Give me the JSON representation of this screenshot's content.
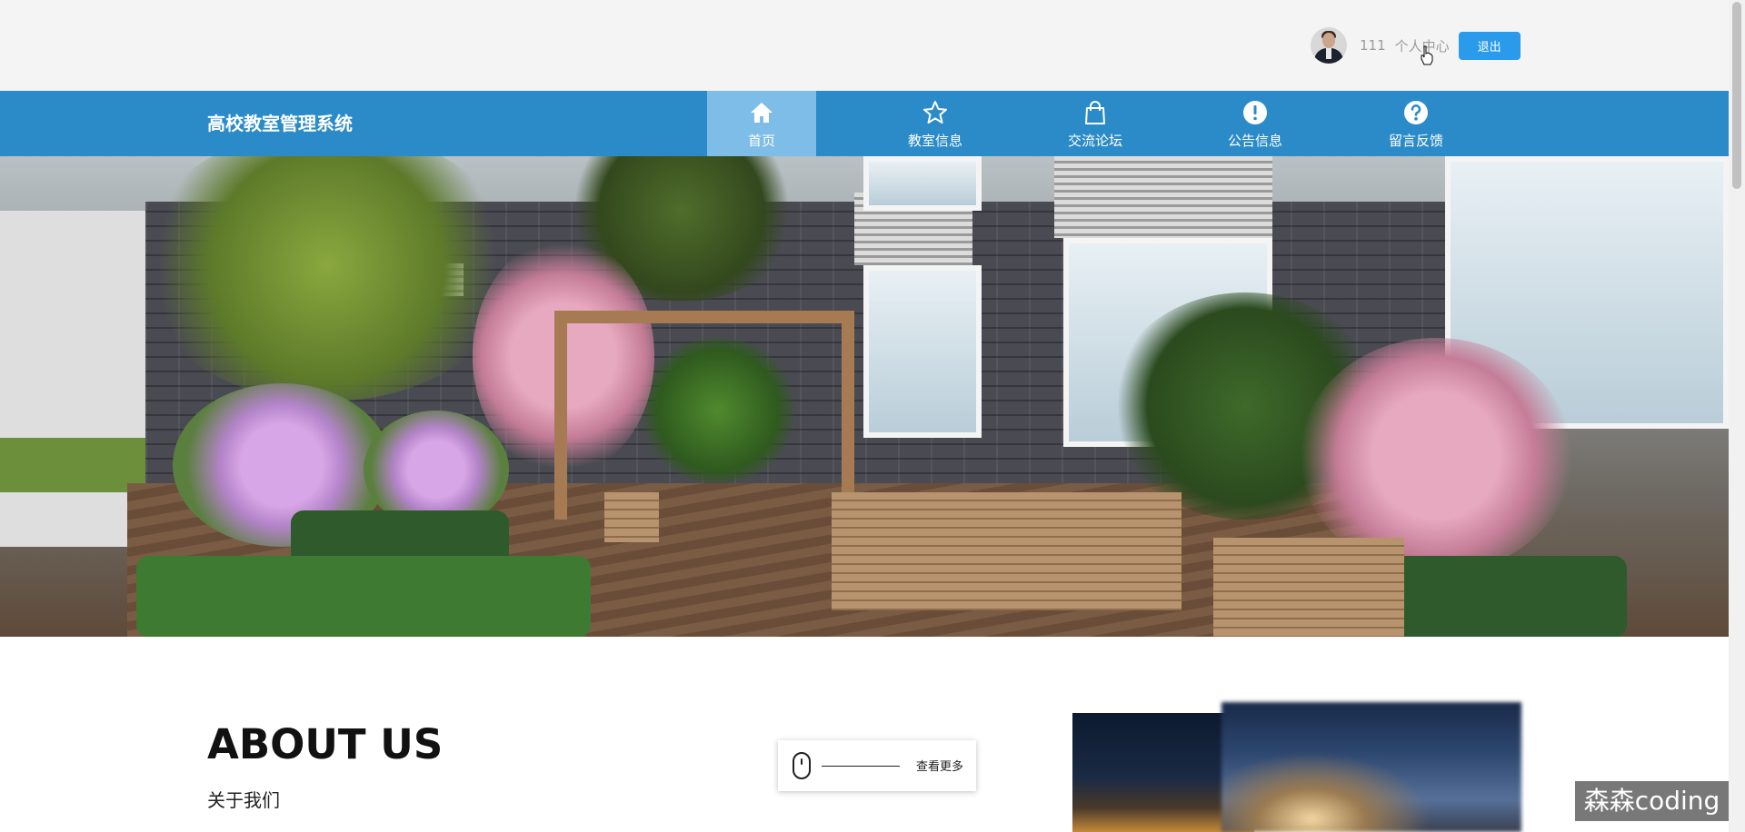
{
  "header": {
    "username": "111",
    "profile_label": "个人中心",
    "logout_label": "退出"
  },
  "nav": {
    "brand": "高校教室管理系统",
    "items": [
      {
        "label": "首页",
        "icon": "home-icon"
      },
      {
        "label": "教室信息",
        "icon": "star-icon"
      },
      {
        "label": "交流论坛",
        "icon": "shopping-bag-icon"
      },
      {
        "label": "公告信息",
        "icon": "exclamation-circle-icon"
      },
      {
        "label": "留言反馈",
        "icon": "question-circle-icon"
      }
    ],
    "active_index": 0
  },
  "banner": {
    "slide_count": 3,
    "active_slide": 3
  },
  "about": {
    "title": "ABOUT US",
    "subtitle": "关于我们",
    "more_label": "查看更多"
  },
  "watermark": "森森coding",
  "colors": {
    "nav_bg": "#2b8bc9",
    "nav_active": "#7dbde8",
    "accent": "#2a9bea",
    "page_bg": "#f4f4f4"
  }
}
